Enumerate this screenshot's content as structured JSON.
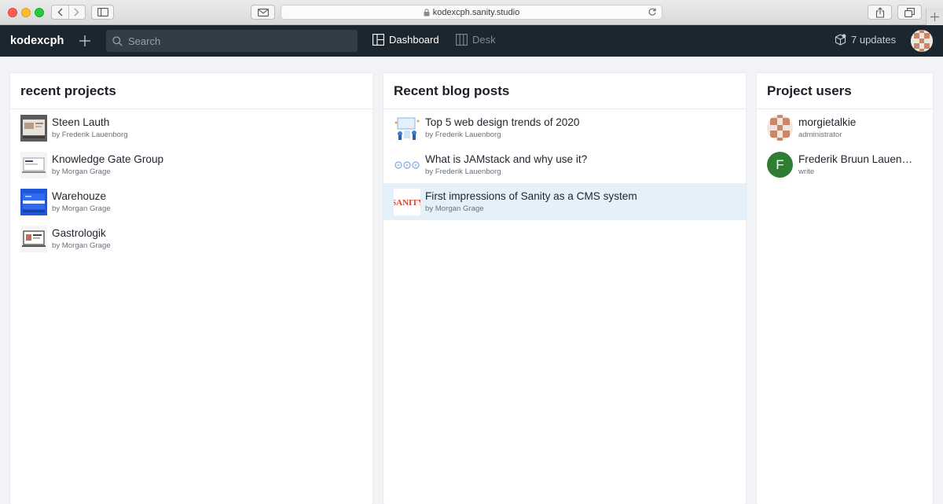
{
  "browser": {
    "url": "kodexcph.sanity.studio"
  },
  "navbar": {
    "brand": "kodexcph",
    "search_placeholder": "Search",
    "tools": [
      {
        "label": "Dashboard",
        "icon": "dashboard-icon",
        "active": true
      },
      {
        "label": "Desk",
        "icon": "desk-icon",
        "active": false
      }
    ],
    "updates_label": "7 updates"
  },
  "panels": {
    "projects": {
      "title": "recent projects",
      "items": [
        {
          "title": "Steen Lauth",
          "subtitle": "by Frederik Lauenborg"
        },
        {
          "title": "Knowledge Gate Group",
          "subtitle": "by Morgan Grage"
        },
        {
          "title": "Warehouze",
          "subtitle": "by Morgan Grage"
        },
        {
          "title": "Gastrologik",
          "subtitle": "by Morgan Grage"
        }
      ]
    },
    "blog": {
      "title": "Recent blog posts",
      "items": [
        {
          "title": "Top 5 web design trends of 2020",
          "subtitle": "by Frederik Lauenborg"
        },
        {
          "title": "What is JAMstack and why use it?",
          "subtitle": "by Frederik Lauenborg"
        },
        {
          "title": "First impressions of Sanity as a CMS system",
          "subtitle": "by Morgan Grage",
          "selected": true,
          "thumb_text": "SANITY"
        }
      ]
    },
    "users": {
      "title": "Project users",
      "items": [
        {
          "name": "morgietalkie",
          "role": "administrator"
        },
        {
          "name": "Frederik Bruun Lauenborg",
          "role": "write",
          "initial": "F"
        }
      ]
    }
  },
  "colors": {
    "navbar_bg": "#1b262f",
    "selected_row": "#e4f1fa",
    "avatar_green": "#2e7d32"
  }
}
